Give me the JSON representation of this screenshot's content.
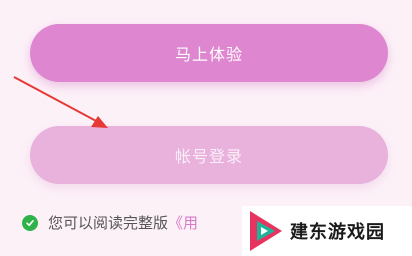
{
  "buttons": {
    "experience_label": "马上体验",
    "login_label": "帐号登录"
  },
  "agreement": {
    "text": "您可以阅读完整版",
    "link_text": "《用"
  },
  "watermark": {
    "text": "建东游戏园"
  },
  "colors": {
    "background": "#fdf1f8",
    "primary_button": "#de86cf",
    "secondary_button": "#e8b2dc",
    "check": "#2fb24a",
    "link": "#d77ac8",
    "annotation_arrow": "#e53935"
  }
}
